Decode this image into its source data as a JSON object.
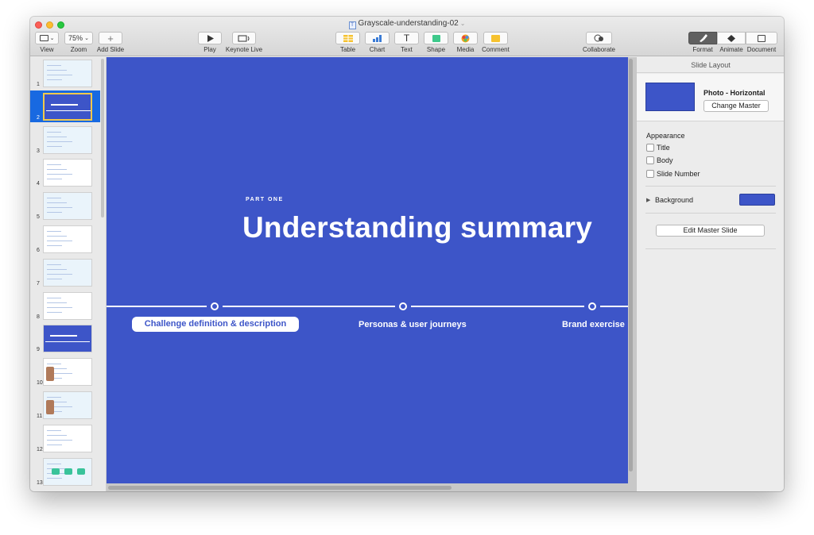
{
  "window": {
    "document_title": "Grayscale-understanding-02"
  },
  "toolbar": {
    "view_label": "View",
    "zoom_value": "75%",
    "zoom_label": "Zoom",
    "add_slide_label": "Add Slide",
    "play_label": "Play",
    "keynote_live_label": "Keynote Live",
    "table_label": "Table",
    "chart_label": "Chart",
    "text_label": "Text",
    "shape_label": "Shape",
    "media_label": "Media",
    "comment_label": "Comment",
    "collaborate_label": "Collaborate",
    "format_label": "Format",
    "animate_label": "Animate",
    "document_label": "Document"
  },
  "navigator": {
    "selected_slide": 2,
    "slides": [
      {
        "number": "1",
        "style": "white"
      },
      {
        "number": "2",
        "style": "blue"
      },
      {
        "number": "3",
        "style": "white"
      },
      {
        "number": "4",
        "style": "white"
      },
      {
        "number": "5",
        "style": "white"
      },
      {
        "number": "6",
        "style": "white"
      },
      {
        "number": "7",
        "style": "white"
      },
      {
        "number": "8",
        "style": "white"
      },
      {
        "number": "9",
        "style": "blue"
      },
      {
        "number": "10",
        "style": "white"
      },
      {
        "number": "11",
        "style": "white"
      },
      {
        "number": "12",
        "style": "white"
      },
      {
        "number": "13",
        "style": "white"
      }
    ]
  },
  "slide": {
    "background_color": "#3d55c8",
    "eyebrow": "PART ONE",
    "title": "Understanding summary",
    "timeline": {
      "active_step": "Challenge definition & description",
      "step_2": "Personas & user journeys",
      "step_3": "Brand exercise"
    }
  },
  "inspector": {
    "header": "Slide Layout",
    "master_name": "Photo - Horizontal",
    "change_master_label": "Change Master",
    "appearance_title": "Appearance",
    "checkbox_title": "Title",
    "checkbox_body": "Body",
    "checkbox_slide_number": "Slide Number",
    "background_label": "Background",
    "background_color": "#3d55c8",
    "edit_master_label": "Edit Master Slide"
  }
}
